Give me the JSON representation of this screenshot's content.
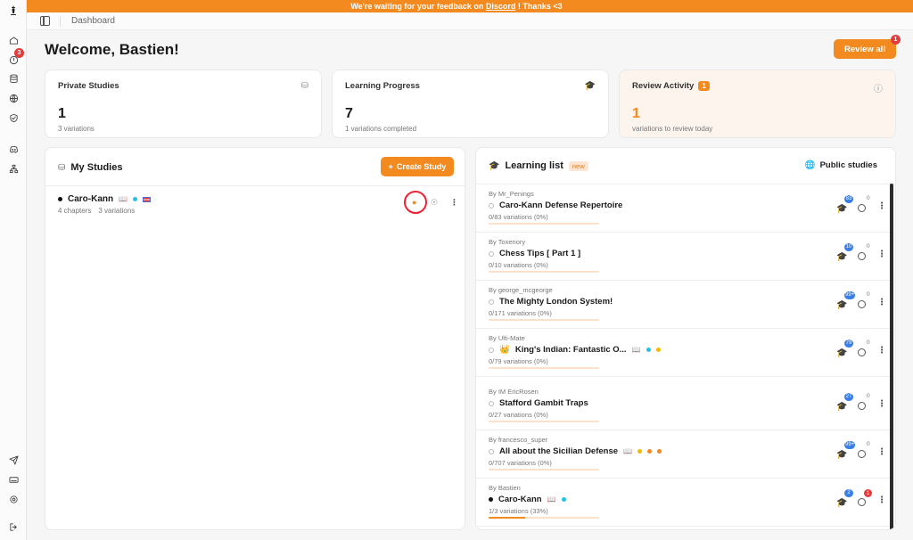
{
  "banner": {
    "pre": "We're waiting for your feedback on ",
    "link": "Discord",
    "post": " ! Thanks <3"
  },
  "topbar": {
    "breadcrumb": "Dashboard"
  },
  "rail": {
    "notif_count": "3"
  },
  "header": {
    "welcome": "Welcome, Bastien!",
    "review_all": "Review all",
    "review_badge": "1"
  },
  "stats": {
    "private": {
      "title": "Private Studies",
      "value": "1",
      "sub": "3 variations"
    },
    "learning": {
      "title": "Learning Progress",
      "value": "7",
      "sub": "1 variations completed"
    },
    "review": {
      "title": "Review Activity",
      "badge": "1",
      "value": "1",
      "sub": "variations to review today"
    }
  },
  "my_studies": {
    "title": "My Studies",
    "create": "Create Study",
    "studies": [
      {
        "name": "Caro-Kann",
        "chapters": "4 chapters",
        "variations": "3 variations"
      }
    ]
  },
  "learning_list": {
    "title": "Learning list",
    "tag": "new",
    "public": "Public studies",
    "items": [
      {
        "by": "By Mr_Penings",
        "name": "Caro-Kann Defense Repertoire",
        "progress": "0/83 variations (0%)",
        "pct": 0,
        "count": "83",
        "review": "0"
      },
      {
        "by": "By Toxenory",
        "name": "Chess Tips [ Part 1 ]",
        "progress": "0/10 variations (0%)",
        "pct": 0,
        "count": "10",
        "review": "0"
      },
      {
        "by": "By george_mcgeorge",
        "name": "The Mighty London System!",
        "progress": "0/171 variations (0%)",
        "pct": 0,
        "count": "99+",
        "review": "0"
      },
      {
        "by": "By Ulti-Mate",
        "name": "King's Indian: Fantastic O...",
        "progress": "0/79 variations (0%)",
        "pct": 0,
        "count": "79",
        "review": "0"
      },
      {
        "by": "By IM EricRosen",
        "name": "Stafford Gambit Traps",
        "progress": "0/27 variations (0%)",
        "pct": 0,
        "count": "27",
        "review": "0"
      },
      {
        "by": "By francesco_super",
        "name": "All about the Sicilian Defense",
        "progress": "0/707 variations (0%)",
        "pct": 0,
        "count": "99+",
        "review": "0"
      },
      {
        "by": "By Bastien",
        "name": "Caro-Kann",
        "progress": "1/3 variations (33%)",
        "pct": 33,
        "count": "2",
        "review": "1"
      }
    ]
  }
}
